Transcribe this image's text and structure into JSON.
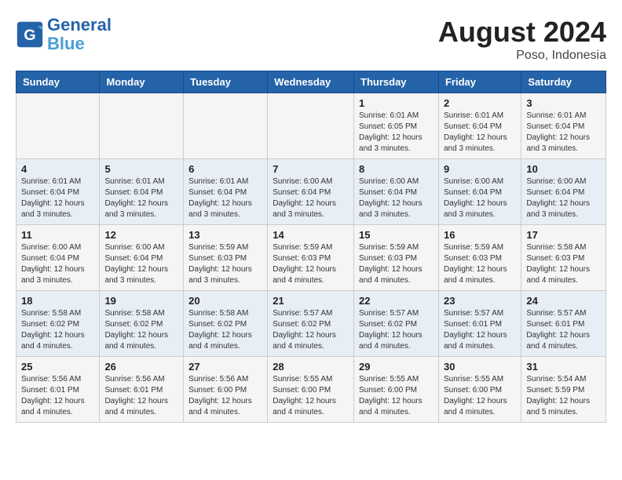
{
  "header": {
    "logo_line1": "General",
    "logo_line2": "Blue",
    "month_year": "August 2024",
    "location": "Poso, Indonesia"
  },
  "weekdays": [
    "Sunday",
    "Monday",
    "Tuesday",
    "Wednesday",
    "Thursday",
    "Friday",
    "Saturday"
  ],
  "weeks": [
    [
      {
        "day": "",
        "info": ""
      },
      {
        "day": "",
        "info": ""
      },
      {
        "day": "",
        "info": ""
      },
      {
        "day": "",
        "info": ""
      },
      {
        "day": "1",
        "info": "Sunrise: 6:01 AM\nSunset: 6:05 PM\nDaylight: 12 hours\nand 3 minutes."
      },
      {
        "day": "2",
        "info": "Sunrise: 6:01 AM\nSunset: 6:04 PM\nDaylight: 12 hours\nand 3 minutes."
      },
      {
        "day": "3",
        "info": "Sunrise: 6:01 AM\nSunset: 6:04 PM\nDaylight: 12 hours\nand 3 minutes."
      }
    ],
    [
      {
        "day": "4",
        "info": "Sunrise: 6:01 AM\nSunset: 6:04 PM\nDaylight: 12 hours\nand 3 minutes."
      },
      {
        "day": "5",
        "info": "Sunrise: 6:01 AM\nSunset: 6:04 PM\nDaylight: 12 hours\nand 3 minutes."
      },
      {
        "day": "6",
        "info": "Sunrise: 6:01 AM\nSunset: 6:04 PM\nDaylight: 12 hours\nand 3 minutes."
      },
      {
        "day": "7",
        "info": "Sunrise: 6:00 AM\nSunset: 6:04 PM\nDaylight: 12 hours\nand 3 minutes."
      },
      {
        "day": "8",
        "info": "Sunrise: 6:00 AM\nSunset: 6:04 PM\nDaylight: 12 hours\nand 3 minutes."
      },
      {
        "day": "9",
        "info": "Sunrise: 6:00 AM\nSunset: 6:04 PM\nDaylight: 12 hours\nand 3 minutes."
      },
      {
        "day": "10",
        "info": "Sunrise: 6:00 AM\nSunset: 6:04 PM\nDaylight: 12 hours\nand 3 minutes."
      }
    ],
    [
      {
        "day": "11",
        "info": "Sunrise: 6:00 AM\nSunset: 6:04 PM\nDaylight: 12 hours\nand 3 minutes."
      },
      {
        "day": "12",
        "info": "Sunrise: 6:00 AM\nSunset: 6:04 PM\nDaylight: 12 hours\nand 3 minutes."
      },
      {
        "day": "13",
        "info": "Sunrise: 5:59 AM\nSunset: 6:03 PM\nDaylight: 12 hours\nand 3 minutes."
      },
      {
        "day": "14",
        "info": "Sunrise: 5:59 AM\nSunset: 6:03 PM\nDaylight: 12 hours\nand 4 minutes."
      },
      {
        "day": "15",
        "info": "Sunrise: 5:59 AM\nSunset: 6:03 PM\nDaylight: 12 hours\nand 4 minutes."
      },
      {
        "day": "16",
        "info": "Sunrise: 5:59 AM\nSunset: 6:03 PM\nDaylight: 12 hours\nand 4 minutes."
      },
      {
        "day": "17",
        "info": "Sunrise: 5:58 AM\nSunset: 6:03 PM\nDaylight: 12 hours\nand 4 minutes."
      }
    ],
    [
      {
        "day": "18",
        "info": "Sunrise: 5:58 AM\nSunset: 6:02 PM\nDaylight: 12 hours\nand 4 minutes."
      },
      {
        "day": "19",
        "info": "Sunrise: 5:58 AM\nSunset: 6:02 PM\nDaylight: 12 hours\nand 4 minutes."
      },
      {
        "day": "20",
        "info": "Sunrise: 5:58 AM\nSunset: 6:02 PM\nDaylight: 12 hours\nand 4 minutes."
      },
      {
        "day": "21",
        "info": "Sunrise: 5:57 AM\nSunset: 6:02 PM\nDaylight: 12 hours\nand 4 minutes."
      },
      {
        "day": "22",
        "info": "Sunrise: 5:57 AM\nSunset: 6:02 PM\nDaylight: 12 hours\nand 4 minutes."
      },
      {
        "day": "23",
        "info": "Sunrise: 5:57 AM\nSunset: 6:01 PM\nDaylight: 12 hours\nand 4 minutes."
      },
      {
        "day": "24",
        "info": "Sunrise: 5:57 AM\nSunset: 6:01 PM\nDaylight: 12 hours\nand 4 minutes."
      }
    ],
    [
      {
        "day": "25",
        "info": "Sunrise: 5:56 AM\nSunset: 6:01 PM\nDaylight: 12 hours\nand 4 minutes."
      },
      {
        "day": "26",
        "info": "Sunrise: 5:56 AM\nSunset: 6:01 PM\nDaylight: 12 hours\nand 4 minutes."
      },
      {
        "day": "27",
        "info": "Sunrise: 5:56 AM\nSunset: 6:00 PM\nDaylight: 12 hours\nand 4 minutes."
      },
      {
        "day": "28",
        "info": "Sunrise: 5:55 AM\nSunset: 6:00 PM\nDaylight: 12 hours\nand 4 minutes."
      },
      {
        "day": "29",
        "info": "Sunrise: 5:55 AM\nSunset: 6:00 PM\nDaylight: 12 hours\nand 4 minutes."
      },
      {
        "day": "30",
        "info": "Sunrise: 5:55 AM\nSunset: 6:00 PM\nDaylight: 12 hours\nand 4 minutes."
      },
      {
        "day": "31",
        "info": "Sunrise: 5:54 AM\nSunset: 5:59 PM\nDaylight: 12 hours\nand 5 minutes."
      }
    ]
  ]
}
